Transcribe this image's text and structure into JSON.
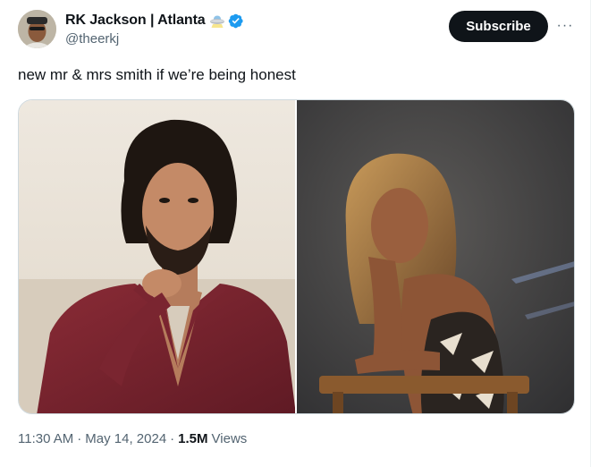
{
  "author": {
    "display_name": "RK Jackson | Atlanta",
    "handle": "@theerkj",
    "emoji_icon": "ufo-icon",
    "verified_icon": "verified-badge-icon",
    "verified_color": "#1d9bf0"
  },
  "actions": {
    "subscribe_label": "Subscribe",
    "more_label": "···"
  },
  "tweet": {
    "text": "new mr & mrs smith if we’re being honest"
  },
  "media": {
    "left_photo": "man-portrait-photo",
    "right_photo": "woman-portrait-photo"
  },
  "meta": {
    "time": "11:30 AM",
    "separator_1": "·",
    "date": "May 14, 2024",
    "separator_2": "·",
    "views_count": "1.5M",
    "views_label": "Views"
  },
  "colors": {
    "text_primary": "#0f1419",
    "text_secondary": "#536471",
    "border": "#cfd9de",
    "button_bg": "#0f1419"
  }
}
